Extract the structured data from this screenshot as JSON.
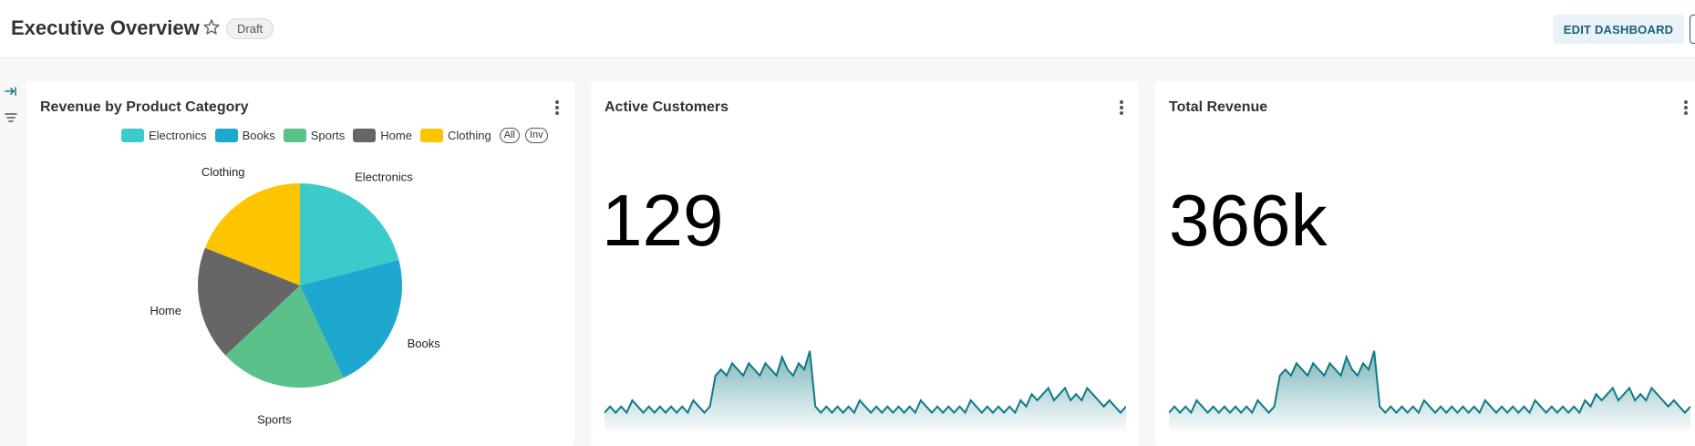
{
  "header": {
    "title": "Executive Overview",
    "badge": "Draft",
    "edit_button": "EDIT DASHBOARD"
  },
  "sidebar": {
    "icons": [
      "collapse-expand-icon",
      "filter-icon"
    ]
  },
  "colors": {
    "accent": "#1a7f8c",
    "sparkline": "#0f7a85",
    "Electronics": "#3ccbcb",
    "Books": "#1fa8cf",
    "Sports": "#5ac18a",
    "Home": "#666666",
    "Clothing": "#fcc500"
  },
  "cards": {
    "revenue": {
      "title": "Revenue by Product Category",
      "legend_all": "All",
      "legend_inv": "Inv"
    },
    "customers": {
      "title": "Active Customers",
      "value": "129"
    },
    "total_revenue": {
      "title": "Total Revenue",
      "value": "366k"
    }
  },
  "chart_data": [
    {
      "type": "pie",
      "title": "Revenue by Product Category",
      "categories": [
        "Electronics",
        "Books",
        "Sports",
        "Home",
        "Clothing"
      ],
      "values": [
        21,
        22,
        20,
        18,
        19
      ],
      "legend": "top"
    },
    {
      "type": "area",
      "title": "Active Customers",
      "series": [
        {
          "values": [
            2,
            3,
            2,
            3,
            2,
            4,
            3,
            2,
            3,
            2,
            3,
            2,
            3,
            2,
            3,
            2,
            4,
            3,
            2,
            3,
            8,
            9,
            8,
            10,
            9,
            8,
            10,
            9,
            8,
            10,
            9,
            8,
            11,
            9,
            8,
            10,
            9,
            12,
            3,
            2,
            3,
            2,
            3,
            2,
            3,
            2,
            4,
            3,
            2,
            3,
            2,
            3,
            2,
            3,
            2,
            3,
            2,
            4,
            3,
            2,
            3,
            2,
            3,
            2,
            3,
            2,
            4,
            3,
            2,
            3,
            2,
            3,
            2,
            3,
            2,
            4,
            3,
            5,
            4,
            5,
            6,
            4,
            5,
            6,
            4,
            5,
            4,
            6,
            5,
            4,
            3,
            4,
            3,
            2,
            3
          ]
        }
      ]
    },
    {
      "type": "area",
      "title": "Total Revenue",
      "series": [
        {
          "values": [
            2,
            3,
            2,
            3,
            2,
            4,
            3,
            2,
            3,
            2,
            3,
            2,
            3,
            2,
            3,
            2,
            4,
            3,
            2,
            3,
            8,
            9,
            8,
            10,
            9,
            8,
            10,
            9,
            8,
            10,
            9,
            8,
            11,
            9,
            8,
            10,
            9,
            12,
            3,
            2,
            3,
            2,
            3,
            2,
            3,
            2,
            4,
            3,
            2,
            3,
            2,
            3,
            2,
            3,
            2,
            3,
            2,
            4,
            3,
            2,
            3,
            2,
            3,
            2,
            3,
            2,
            4,
            3,
            2,
            3,
            2,
            3,
            2,
            3,
            2,
            4,
            3,
            5,
            4,
            5,
            6,
            4,
            5,
            6,
            4,
            5,
            4,
            6,
            5,
            4,
            3,
            4,
            3,
            2,
            3
          ]
        }
      ]
    }
  ]
}
